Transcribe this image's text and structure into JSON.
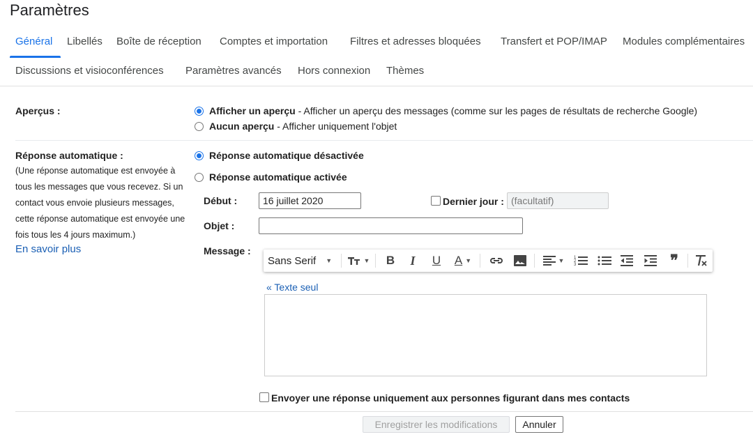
{
  "page": {
    "title": "Paramètres"
  },
  "tabs": [
    {
      "label": "Général",
      "active": true
    },
    {
      "label": "Libellés"
    },
    {
      "label": "Boîte de réception"
    },
    {
      "label": "Comptes et importation"
    },
    {
      "label": "Filtres et adresses bloquées"
    },
    {
      "label": "Transfert et POP/IMAP"
    },
    {
      "label": "Modules complémentaires"
    },
    {
      "label": "Discussions et visioconférences"
    },
    {
      "label": "Paramètres avancés"
    },
    {
      "label": "Hors connexion"
    },
    {
      "label": "Thèmes"
    }
  ],
  "apercus": {
    "label": "Aperçus :",
    "option1_bold": "Afficher un aperçu",
    "option1_rest": " - Afficher un aperçu des messages (comme sur les pages de résultats de recherche Google)",
    "option2_bold": "Aucun aperçu",
    "option2_rest": " - Afficher uniquement l'objet",
    "selected": "option1"
  },
  "auto_reply": {
    "label": "Réponse automatique :",
    "description": "(Une réponse automatique est envoyée à tous les messages que vous recevez. Si un contact vous envoie plusieurs messages, cette réponse automatique est envoyée une fois tous les 4 jours maximum.)",
    "learn_more": "En savoir plus",
    "off_label": "Réponse automatique désactivée",
    "on_label": "Réponse automatique activée",
    "selected": "off",
    "start_label": "Début :",
    "start_value": "16 juillet 2020",
    "last_day_label": "Dernier jour :",
    "last_day_placeholder": "(facultatif)",
    "subject_label": "Objet :",
    "subject_value": "",
    "message_label": "Message :",
    "font_name": "Sans Serif",
    "plain_text_link": "« Texte seul",
    "contacts_only_label": "Envoyer une réponse uniquement aux personnes figurant dans mes contacts"
  },
  "footer": {
    "save_label": "Enregistrer les modifications",
    "cancel_label": "Annuler"
  },
  "colors": {
    "accent": "#1a73e8",
    "link": "#1a5fb4"
  },
  "toolbar_icons": [
    "font-family-select",
    "text-size-icon",
    "bold-icon",
    "italic-icon",
    "underline-icon",
    "text-color-icon",
    "link-icon",
    "image-icon",
    "align-icon",
    "numbered-list-icon",
    "bulleted-list-icon",
    "indent-less-icon",
    "indent-more-icon",
    "quote-icon",
    "remove-formatting-icon"
  ]
}
